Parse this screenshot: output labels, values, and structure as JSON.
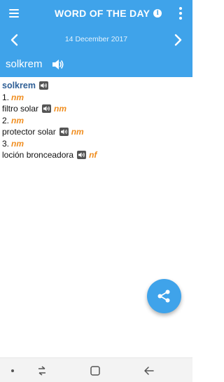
{
  "header": {
    "title": "WORD OF THE DAY",
    "info_icon": "info-icon",
    "menu_icon": "hamburger-menu-icon",
    "more_icon": "more-vertical-icon"
  },
  "date_nav": {
    "date": "14 December 2017",
    "prev_icon": "chevron-left-icon",
    "next_icon": "chevron-right-icon"
  },
  "word_bar": {
    "word": "solkrem",
    "audio_icon": "speaker-icon"
  },
  "entry": {
    "headword": "solkrem",
    "senses": [
      {
        "number": "1.",
        "pos": "nm",
        "translation": "filtro solar",
        "translation_pos": "nm"
      },
      {
        "number": "2.",
        "pos": "nm",
        "translation": "protector solar",
        "translation_pos": "nm"
      },
      {
        "number": "3.",
        "pos": "nm",
        "translation": "loción bronceadora",
        "translation_pos": "nf"
      }
    ]
  },
  "fab": {
    "icon": "share-icon"
  },
  "system_nav": {
    "icons": [
      "dot-icon",
      "recents-icon",
      "home-icon",
      "back-icon"
    ]
  },
  "colors": {
    "primary": "#3fa3ea",
    "headword": "#2f5f96",
    "pos": "#f08d1e"
  }
}
